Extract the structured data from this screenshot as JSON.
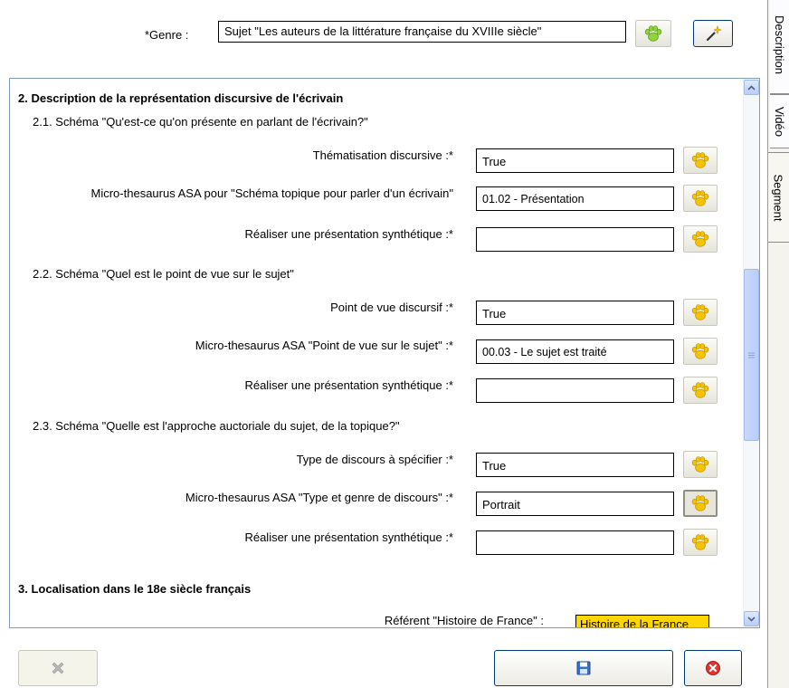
{
  "header": {
    "genre_label": "*Genre :",
    "genre_value": "Sujet \"Les auteurs de la littérature française du XVIIIe siècle\""
  },
  "side_tabs": [
    "Description",
    "Vidéo",
    "Segment"
  ],
  "sections": [
    {
      "title": "2. Description de la représentation discursive de l'écrivain",
      "schemas": [
        {
          "title": "2.1. Schéma \"Qu'est-ce qu'on présente en parlant de l'écrivain?\"",
          "fields": [
            {
              "label": "Thématisation discursive :*",
              "value": "True"
            },
            {
              "label": "Micro-thesaurus ASA pour \"Schéma topique pour parler d'un écrivain\"",
              "value": "01.02 - Présentation"
            },
            {
              "label": "Réaliser une présentation synthétique :*",
              "value": ""
            }
          ]
        },
        {
          "title": "2.2. Schéma \"Quel est le point de vue sur le sujet\"",
          "fields": [
            {
              "label": "Point de vue discursif :*",
              "value": "True"
            },
            {
              "label": "Micro-thesaurus ASA \"Point de vue sur le sujet\" :*",
              "value": "00.03 - Le sujet est traité"
            },
            {
              "label": "Réaliser une présentation synthétique :*",
              "value": ""
            }
          ]
        },
        {
          "title": "2.3. Schéma \"Quelle est l'approche auctoriale du sujet, de la topique?\"",
          "fields": [
            {
              "label": "Type de discours à spécifier :*",
              "value": "True"
            },
            {
              "label": "Micro-thesaurus ASA \"Type et genre de discours\" :*",
              "value": "Portrait"
            },
            {
              "label": "Réaliser une présentation synthétique :*",
              "value": ""
            }
          ]
        }
      ]
    },
    {
      "title": "3. Localisation dans le 18e siècle français",
      "referent_label": "Référent \"Histoire de France\" :",
      "referent_value": "Histoire de la France"
    }
  ],
  "icons": {
    "paw": "paw-icon",
    "wand": "magic-wand-icon",
    "delete": "delete-icon",
    "save": "save-icon",
    "cancel": "cancel-icon"
  },
  "colors": {
    "paw_yellow": "#f5c400",
    "paw_green": "#8fd43a",
    "referent_bg": "#ffd700"
  }
}
